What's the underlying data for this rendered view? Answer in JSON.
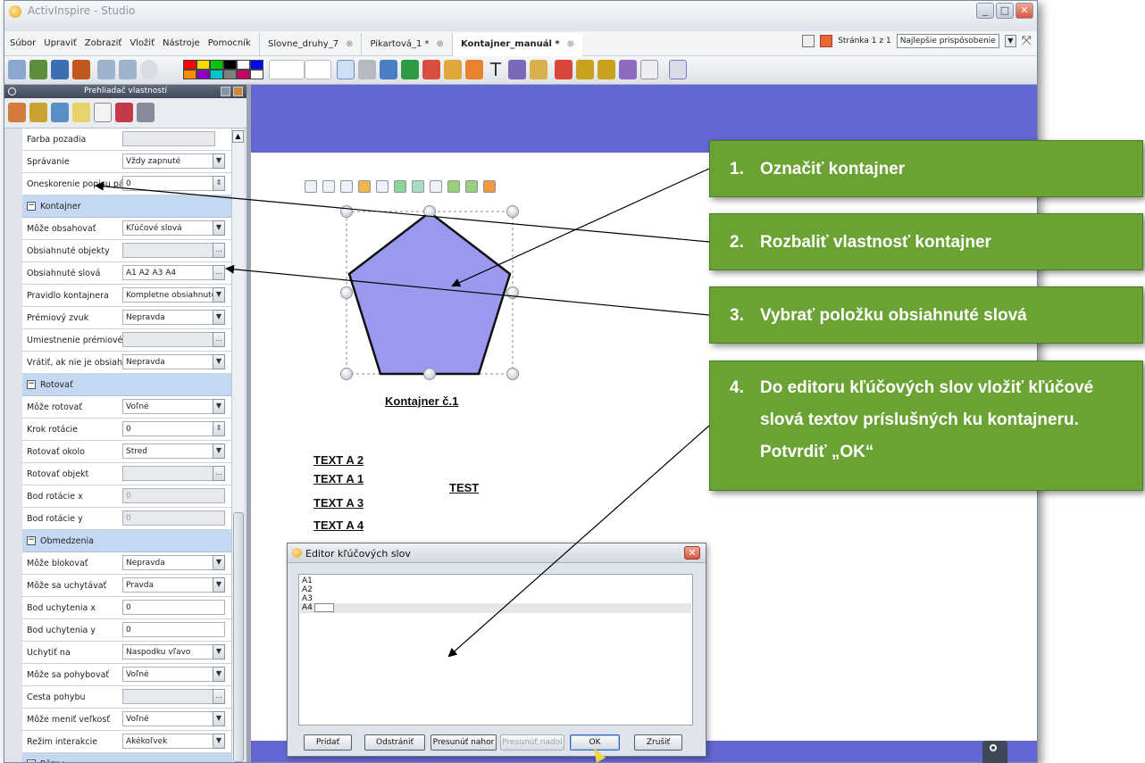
{
  "window": {
    "title": "ActivInspire - Studio",
    "controls": [
      "_",
      "□",
      "✕"
    ]
  },
  "menu": [
    "Súbor",
    "Upraviť",
    "Zobraziť",
    "Vložiť",
    "Nástroje",
    "Pomocník"
  ],
  "doc_tabs": [
    {
      "label": "Slovne_druhy_7",
      "close": "⊗",
      "active": false
    },
    {
      "label": "Pikartová_1 *",
      "close": "⊗",
      "active": false
    },
    {
      "label": "Kontajner_manuál *",
      "close": "⊗",
      "active": true
    }
  ],
  "page_indicator": {
    "label": "Stránka 1 z 1",
    "zoom": "Najlepšie prispôsobenie"
  },
  "toolbar": {
    "colors": [
      "#ff0000",
      "#ffd600",
      "#00c800",
      "#000000",
      "#ffffff",
      "#0000ff",
      "#ff8c00",
      "#8a00c8",
      "#00c8c8",
      "#808080",
      "#c80064",
      "#ffffff"
    ]
  },
  "panel": {
    "title": "Prehliadač vlastností",
    "rows": [
      {
        "type": "prop",
        "label": "Farba pozadia",
        "value": "",
        "gray": true
      },
      {
        "type": "prop",
        "label": "Správanie",
        "value": "Vždy zapnuté",
        "control": "dropdown"
      },
      {
        "type": "prop",
        "label": "Oneskorenie popisu pást",
        "value": "0",
        "control": "spin"
      },
      {
        "type": "section",
        "label": "Kontajner"
      },
      {
        "type": "prop",
        "label": "Môže obsahovať",
        "value": "Kľúčové slová",
        "control": "dropdown"
      },
      {
        "type": "prop",
        "label": "Obsiahnuté objekty",
        "value": "",
        "gray": true,
        "control": "ellipsis"
      },
      {
        "type": "prop",
        "label": "Obsiahnuté slová",
        "value": "A1 A2 A3 A4",
        "control": "ellipsis"
      },
      {
        "type": "prop",
        "label": "Pravidlo kontajnera",
        "value": "Kompletne obsiahnuté",
        "control": "dropdown"
      },
      {
        "type": "prop",
        "label": "Prémiový zvuk",
        "value": "Nepravda",
        "control": "dropdown"
      },
      {
        "type": "prop",
        "label": "Umiestnenie prémiového",
        "value": "",
        "gray": true,
        "control": "ellipsis"
      },
      {
        "type": "prop",
        "label": "Vrátiť, ak nie je obsiahnu",
        "value": "Nepravda",
        "control": "dropdown"
      },
      {
        "type": "section",
        "label": "Rotovať"
      },
      {
        "type": "prop",
        "label": "Môže rotovať",
        "value": "Voľné",
        "control": "dropdown"
      },
      {
        "type": "prop",
        "label": "Krok rotácie",
        "value": "0",
        "control": "spin"
      },
      {
        "type": "prop",
        "label": "Rotovať okolo",
        "value": "Stred",
        "control": "dropdown"
      },
      {
        "type": "prop",
        "label": "Rotovať objekt",
        "value": "",
        "gray": true,
        "control": "ellipsis"
      },
      {
        "type": "prop",
        "label": "Bod rotácie x",
        "value": "0",
        "gray": true,
        "wide": true
      },
      {
        "type": "prop",
        "label": "Bod rotácie y",
        "value": "0",
        "gray": true,
        "wide": true
      },
      {
        "type": "section",
        "label": "Obmedzenia"
      },
      {
        "type": "prop",
        "label": "Môže blokovať",
        "value": "Nepravda",
        "control": "dropdown"
      },
      {
        "type": "prop",
        "label": "Môže sa uchytávať",
        "value": "Pravda",
        "control": "dropdown"
      },
      {
        "type": "prop",
        "label": "Bod uchytenia x",
        "value": "0",
        "wide": true
      },
      {
        "type": "prop",
        "label": "Bod uchytenia y",
        "value": "0",
        "wide": true
      },
      {
        "type": "prop",
        "label": "Uchytiť na",
        "value": "Naspodku vľavo",
        "control": "dropdown"
      },
      {
        "type": "prop",
        "label": "Môže sa pohybovať",
        "value": "Voľné",
        "control": "dropdown"
      },
      {
        "type": "prop",
        "label": "Cesta pohybu",
        "value": "",
        "gray": true,
        "control": "ellipsis"
      },
      {
        "type": "prop",
        "label": "Môže meniť veľkosť",
        "value": "Voľné",
        "control": "dropdown"
      },
      {
        "type": "prop",
        "label": "Režim interakcie",
        "value": "Akékoľvek",
        "control": "dropdown"
      },
      {
        "type": "section",
        "label": "Rôzne"
      }
    ]
  },
  "canvas": {
    "container_label": "Kontajner č.1",
    "texts": [
      "TEXT A 2",
      "TEXT A 1",
      "TEXT A 3",
      "TEXT A 4",
      "TEST"
    ],
    "pentagon_color": "#9999f0",
    "banner_color": "#6466d4"
  },
  "dialog": {
    "title": "Editor kľúčových slov",
    "close": "✕",
    "keywords": [
      "A1",
      "A2",
      "A3",
      "A4"
    ],
    "buttons": [
      {
        "label": "Pridať",
        "disabled": false
      },
      {
        "label": "Odstrániť",
        "disabled": false
      },
      {
        "label": "Presunúť nahor",
        "disabled": false
      },
      {
        "label": "Presunúť nadol",
        "disabled": true
      },
      {
        "label": "OK",
        "disabled": false
      },
      {
        "label": "Zrušiť",
        "disabled": false
      }
    ]
  },
  "callouts": [
    {
      "num": "1.",
      "text": "Označiť kontajner"
    },
    {
      "num": "2.",
      "text": "Rozbaliť vlastnosť kontajner"
    },
    {
      "num": "3.",
      "text": "Vybrať položku obsiahnuté slová"
    },
    {
      "num": "4.",
      "text": "Do editoru kľúčových slov vložiť kľúčové slová textov príslušných ku kontajneru. Potvrdiť „OK“"
    }
  ],
  "callout_color": "#6aa234"
}
